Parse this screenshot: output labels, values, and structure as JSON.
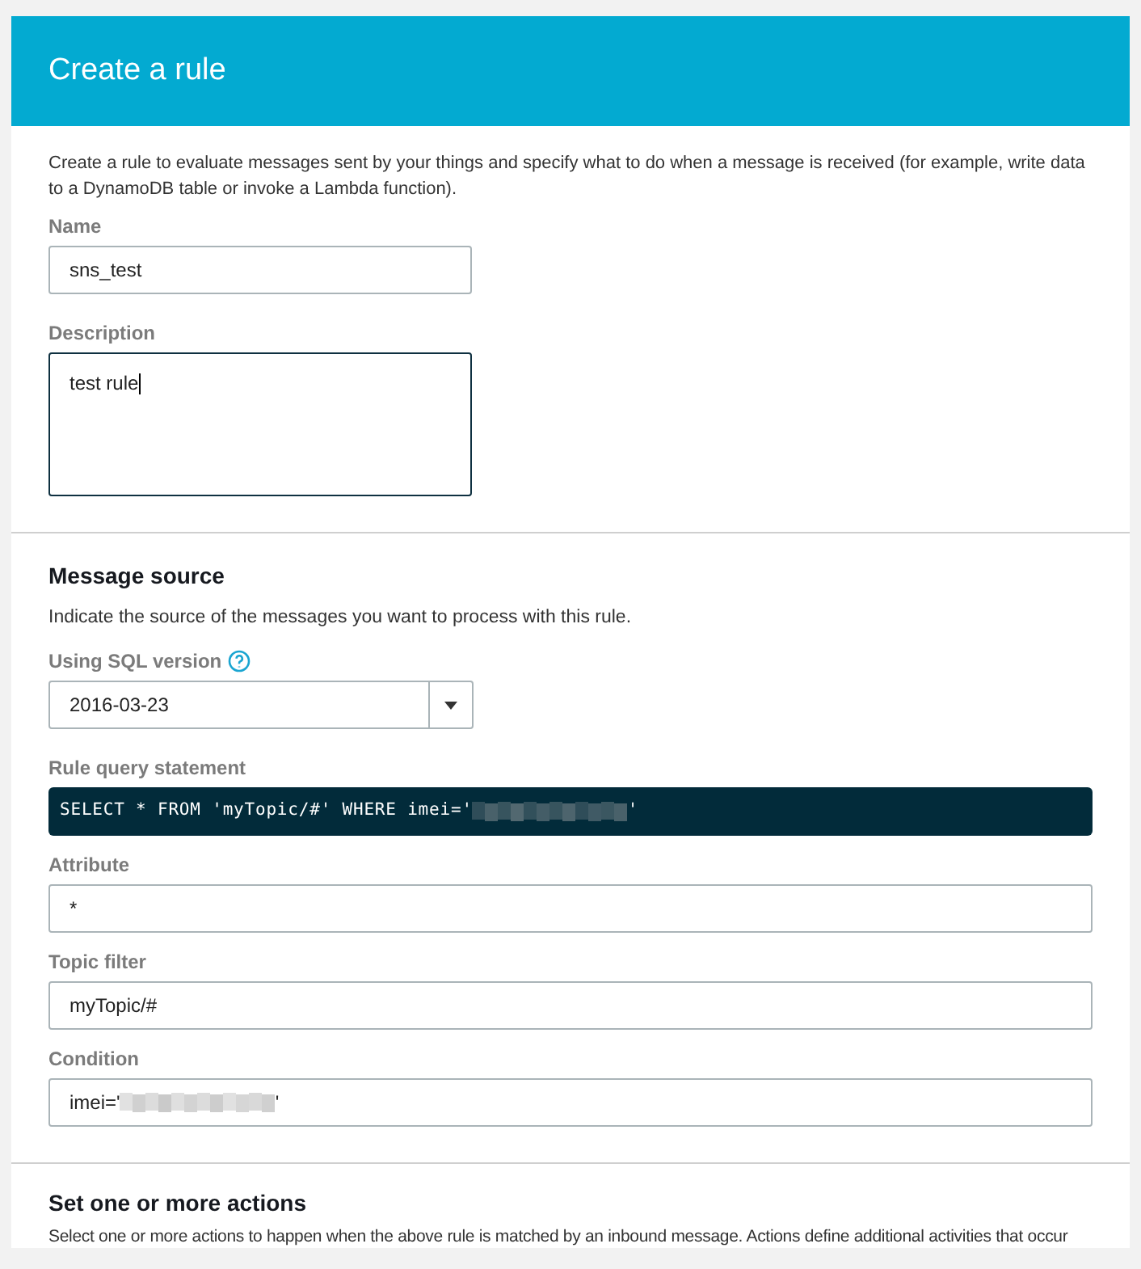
{
  "header": {
    "title": "Create a rule"
  },
  "intro": "Create a rule to evaluate messages sent by your things and specify what to do when a message is received (for example, write data to a DynamoDB table or invoke a Lambda function).",
  "name_field": {
    "label": "Name",
    "value": "sns_test"
  },
  "description_field": {
    "label": "Description",
    "value": "test rule",
    "focused": true
  },
  "message_source": {
    "heading": "Message source",
    "text": "Indicate the source of the messages you want to process with this rule.",
    "sql_version": {
      "label": "Using SQL version",
      "value": "2016-03-23"
    },
    "query": {
      "label": "Rule query statement",
      "segments": [
        {
          "kind": "text",
          "text": "SELECT * FROM 'myTopic/#' WHERE imei='"
        },
        {
          "kind": "redacted"
        },
        {
          "kind": "text",
          "text": "'"
        }
      ]
    },
    "fields": [
      {
        "label": "Attribute",
        "segments": [
          {
            "kind": "text",
            "text": "*"
          }
        ]
      },
      {
        "label": "Topic filter",
        "segments": [
          {
            "kind": "text",
            "text": "myTopic/#"
          }
        ]
      },
      {
        "label": "Condition",
        "segments": [
          {
            "kind": "text",
            "text": "imei='"
          },
          {
            "kind": "redacted"
          },
          {
            "kind": "text",
            "text": "'"
          }
        ]
      }
    ]
  },
  "actions": {
    "heading": "Set one or more actions",
    "text": "Select one or more actions to happen when the above rule is matched by an inbound message. Actions define additional activities that occur"
  }
}
